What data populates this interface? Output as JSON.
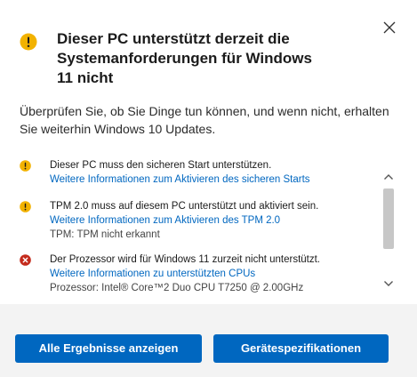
{
  "dialog": {
    "title": "Dieser PC unterstützt derzeit die Systemanforderungen für Windows 11 nicht",
    "subtitle": "Überprüfen Sie, ob Sie Dinge tun können, und wenn nicht, erhalten Sie weiterhin Windows 10 Updates.",
    "title_icon": "warning-icon",
    "close_icon": "close-icon"
  },
  "items": [
    {
      "status": "warning",
      "icon": "warning-icon",
      "text": "Dieser PC muss den sicheren Start unterstützen.",
      "link": "Weitere Informationen zum Aktivieren des sicheren Starts",
      "detail": ""
    },
    {
      "status": "warning",
      "icon": "warning-icon",
      "text": "TPM 2.0 muss auf diesem PC unterstützt und aktiviert sein.",
      "link": "Weitere Informationen zum Aktivieren des TPM 2.0",
      "detail": "TPM: TPM nicht erkannt"
    },
    {
      "status": "error",
      "icon": "error-icon",
      "text": "Der Prozessor wird für Windows 11 zurzeit nicht unterstützt.",
      "link": "Weitere Informationen zu unterstützten CPUs",
      "detail": "Prozessor: Intel® Core™2 Duo CPU T7250 @ 2.00GHz"
    }
  ],
  "buttons": {
    "all_results": "Alle Ergebnisse anzeigen",
    "device_specs": "Gerätespezifikationen"
  },
  "colors": {
    "warning": "#f2b200",
    "error": "#c42b1c",
    "accent": "#0067c0",
    "footer": "#f3f3f3"
  }
}
